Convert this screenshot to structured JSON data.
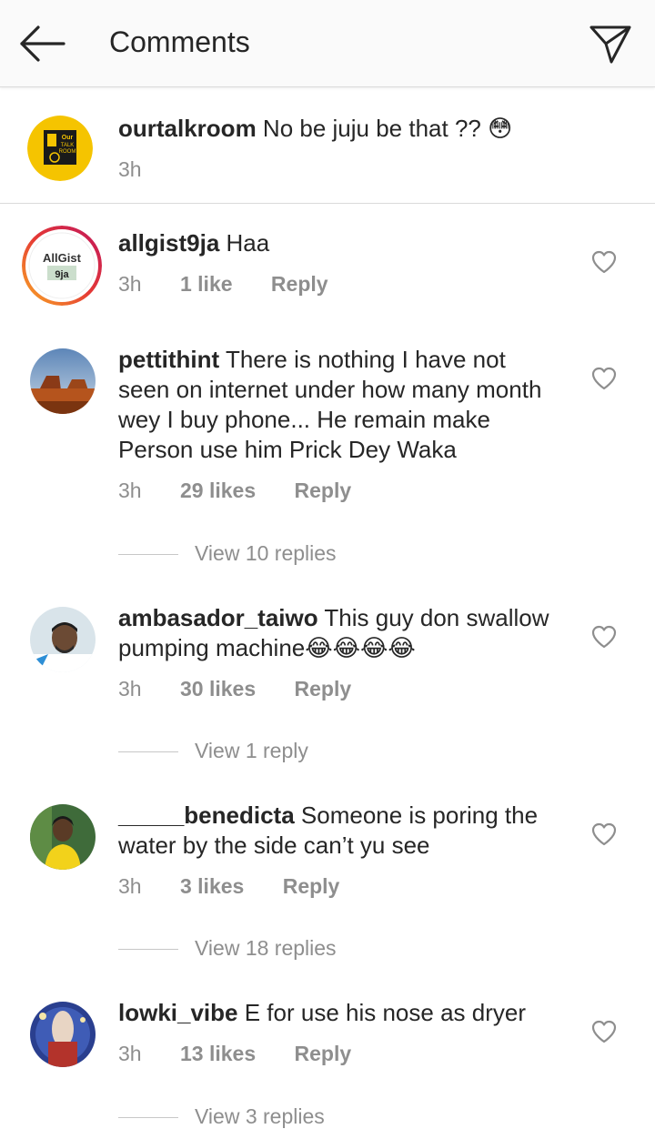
{
  "header": {
    "title": "Comments",
    "back_icon": "arrow-left-icon",
    "send_icon": "paper-plane-icon"
  },
  "caption": {
    "username": "ourtalkroom",
    "text": "No be juju be that ?? 😳",
    "time": "3h"
  },
  "comments": [
    {
      "username": "allgist9ja",
      "text": "Haa",
      "time": "3h",
      "likes": "1 like",
      "reply": "Reply"
    },
    {
      "username": "pettithint",
      "text": "There is nothing I have not seen on internet under how many month wey I buy phone... He remain make Person use him Prick Dey Waka",
      "time": "3h",
      "likes": "29 likes",
      "reply": "Reply",
      "view_replies": "View 10 replies"
    },
    {
      "username": "ambasador_taiwo",
      "text": "This guy don swallow pumping machine😂😂😂😂",
      "time": "3h",
      "likes": "30 likes",
      "reply": "Reply",
      "view_replies": "View 1 reply"
    },
    {
      "username": "_____benedicta",
      "text": "Someone is poring the water by the side can’t yu see",
      "time": "3h",
      "likes": "3 likes",
      "reply": "Reply",
      "view_replies": "View 18 replies"
    },
    {
      "username": "lowki_vibe",
      "text": "E for use his nose as dryer",
      "time": "3h",
      "likes": "13 likes",
      "reply": "Reply",
      "view_replies": "View 3 replies"
    }
  ],
  "avatar_logos": {
    "ourtalkroom_line1": "Our",
    "ourtalkroom_line2": "TALK",
    "ourtalkroom_line3": "ROOM",
    "allgist_line1": "AllGist",
    "allgist_line2": "9ja"
  },
  "colors": {
    "text": "#262626",
    "muted": "#8e8e8e",
    "divider": "#dbdbdb",
    "header_bg": "#fafafa"
  }
}
